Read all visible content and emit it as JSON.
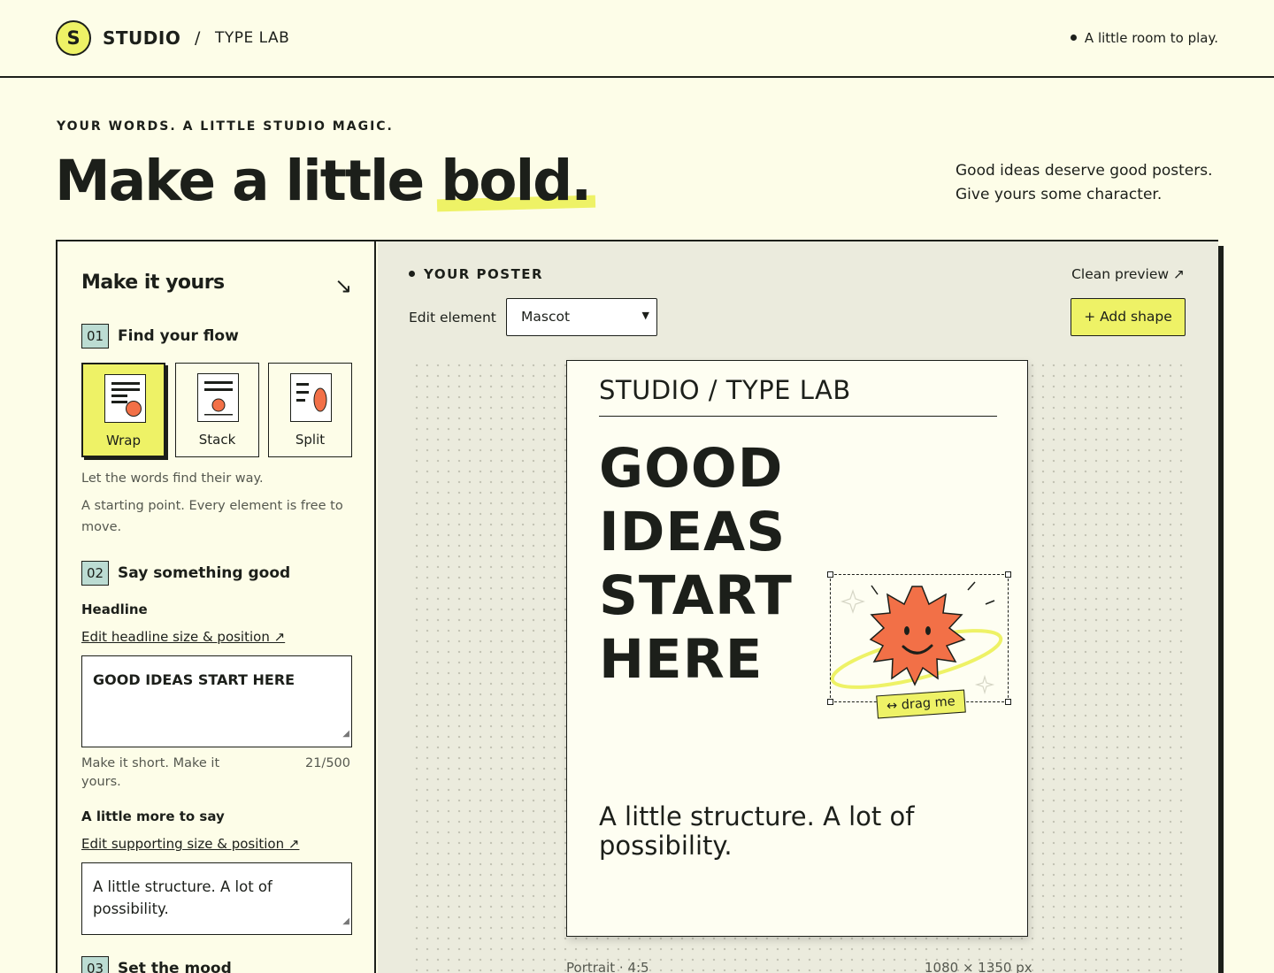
{
  "header": {
    "logo_letter": "S",
    "brand": "STUDIO",
    "separator": "/",
    "sub_brand": "TYPE LAB",
    "tagline": "A little room to play."
  },
  "hero": {
    "eyebrow": "YOUR WORDS. A LITTLE STUDIO MAGIC.",
    "title_start": "Make a little ",
    "title_highlight": "bold.",
    "side_line1": "Good ideas deserve good posters.",
    "side_line2": "Give yours some character."
  },
  "panel": {
    "title": "Make it yours",
    "arrow": "↘",
    "step1": {
      "num": "01",
      "label": "Find your flow"
    },
    "layouts": [
      {
        "label": "Wrap",
        "selected": true
      },
      {
        "label": "Stack",
        "selected": false
      },
      {
        "label": "Split",
        "selected": false
      }
    ],
    "layout_hint": "Let the words find their way.",
    "layout_hint2": "A starting point. Every element is free to move.",
    "step2": {
      "num": "02",
      "label": "Say something good"
    },
    "headline_label": "Headline",
    "headline_link": "Edit headline size & position ↗",
    "headline_value": "GOOD IDEAS START HERE",
    "headline_hint": "Make it short. Make it yours.",
    "headline_count": "21/500",
    "more_label": "A little more to say",
    "more_link": "Edit supporting size & position ↗",
    "more_value": "A little structure. A lot of possibility.",
    "step3": {
      "num": "03",
      "label": "Set the mood"
    }
  },
  "workspace": {
    "label": "YOUR POSTER",
    "clean_preview": "Clean preview ↗",
    "edit_element_label": "Edit element",
    "edit_element_value": "Mascot",
    "add_shape": "+ Add shape",
    "poster": {
      "brand": "STUDIO / TYPE LAB",
      "headline": "GOOD IDEAS START HERE",
      "sub": "A little structure. A lot of possibility.",
      "drag_tag": "↔ drag me"
    },
    "format": "Portrait · 4:5",
    "dimensions": "1080 × 1350 px"
  },
  "colors": {
    "background": "#fdfde8",
    "accent_yellow": "#eef266",
    "mascot_orange": "#f27047",
    "step_teal": "#bcdcd3",
    "ink": "#1c1f1a"
  }
}
